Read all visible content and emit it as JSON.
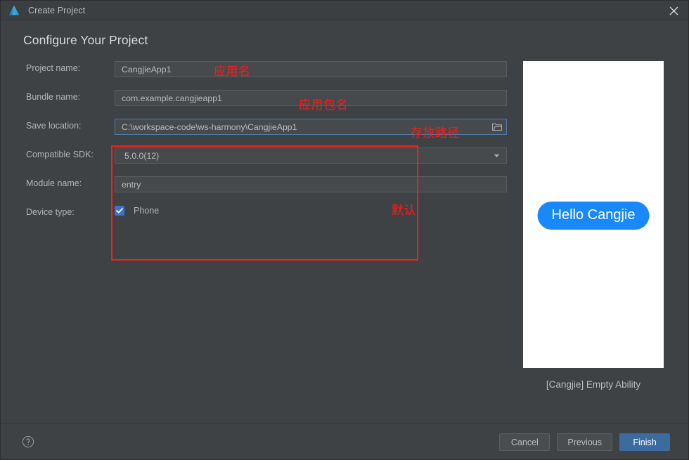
{
  "window": {
    "title": "Create Project",
    "logo_icon": "deveco-logo-icon",
    "close_icon": "close-icon"
  },
  "heading": "Configure Your Project",
  "form": {
    "rows": [
      {
        "label": "Project name:",
        "value": "CangjieApp1",
        "type": "text",
        "spellcheck_underline": true,
        "focused": false
      },
      {
        "label": "Bundle name:",
        "value": "com.example.cangjieapp1",
        "type": "text",
        "spellcheck_underline": false,
        "focused": false
      },
      {
        "label": "Save location:",
        "value": "C:\\workspace-code\\ws-harmony\\CangjieApp1",
        "type": "text-with-browse",
        "trailing_icon": "folder-icon",
        "focused": true
      },
      {
        "label": "Compatible SDK:",
        "value": "5.0.0(12)",
        "type": "combo",
        "trailing_icon": "chevron-down-icon",
        "focused": false
      },
      {
        "label": "Module name:",
        "value": "entry",
        "type": "text",
        "spellcheck_underline": false,
        "focused": false
      }
    ],
    "device_type": {
      "label": "Device type:",
      "checkbox_label": "Phone",
      "checked": true,
      "check_icon": "checkmark-icon"
    }
  },
  "annotations": {
    "app_name": "应用名",
    "package_name": "应用包名",
    "save_path": "存放路径",
    "default": "默认",
    "color": "#ff1a1a"
  },
  "preview": {
    "pill_label": "Hello Cangjie",
    "pill_color": "#1989fa",
    "caption": "[Cangjie] Empty Ability"
  },
  "bottom": {
    "help_icon": "help-circle-icon",
    "cancel": "Cancel",
    "previous": "Previous",
    "finish": "Finish",
    "finish_color": "#3c6ba0"
  }
}
